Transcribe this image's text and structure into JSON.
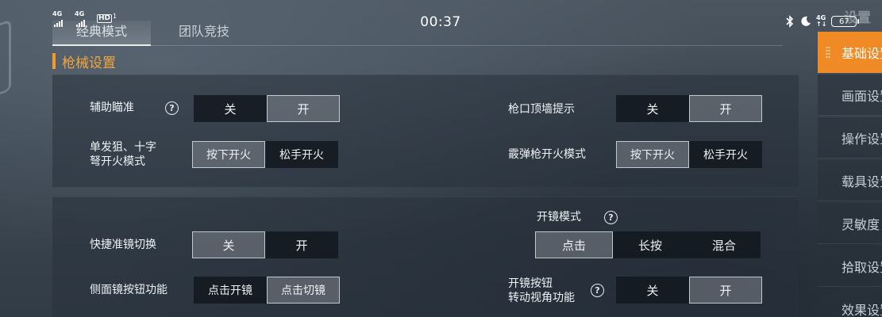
{
  "status_bar": {
    "signal_1": "4G",
    "signal_2": "4G",
    "hd_label": "HD",
    "hd_num": "1",
    "time": "00:37",
    "net_top": "4G",
    "net_bottom": "↑↓",
    "battery": "67"
  },
  "top_tabs": [
    {
      "label": "经典模式",
      "active": true
    },
    {
      "label": "团队竞技",
      "active": false
    }
  ],
  "section": {
    "title": "枪械设置"
  },
  "panel1": {
    "aim_assist": {
      "label": "辅助瞄准",
      "options": [
        "关",
        "开"
      ],
      "selected": 1
    },
    "wall_hint": {
      "label": "枪口顶墙提示",
      "options": [
        "关",
        "开"
      ],
      "selected": 1
    },
    "sniper_fire": {
      "label_line1": "单发狙、十字",
      "label_line2": "弩开火模式",
      "options": [
        "按下开火",
        "松手开火"
      ],
      "selected": 0
    },
    "shotgun_fire": {
      "label": "霰弹枪开火模式",
      "options": [
        "按下开火",
        "松手开火"
      ],
      "selected": 0
    }
  },
  "panel2": {
    "quick_scope": {
      "label": "快捷准镜切换",
      "options": [
        "关",
        "开"
      ],
      "selected": 0
    },
    "scope_mode": {
      "label": "开镜模式",
      "options": [
        "点击",
        "长按",
        "混合"
      ],
      "selected": 0
    },
    "side_scope": {
      "label": "侧面镜按钮功能",
      "options": [
        "点击开镜",
        "点击切镜"
      ],
      "selected": 1
    },
    "scope_rotate": {
      "label_line1": "开镜按钮",
      "label_line2": "转动视角功能",
      "options": [
        "关",
        "开"
      ],
      "selected": 1
    }
  },
  "help_glyph": "?",
  "sidebar": {
    "title": "设置",
    "items": [
      {
        "label": "基础设置",
        "active": true
      },
      {
        "label": "画面设置",
        "active": false
      },
      {
        "label": "操作设置",
        "active": false
      },
      {
        "label": "载具设置",
        "active": false
      },
      {
        "label": "灵敏度",
        "active": false
      },
      {
        "label": "拾取设置",
        "active": false
      },
      {
        "label": "效果设置",
        "active": false
      }
    ]
  },
  "colors": {
    "accent": "#f08a24",
    "heading": "#f3a53a"
  }
}
